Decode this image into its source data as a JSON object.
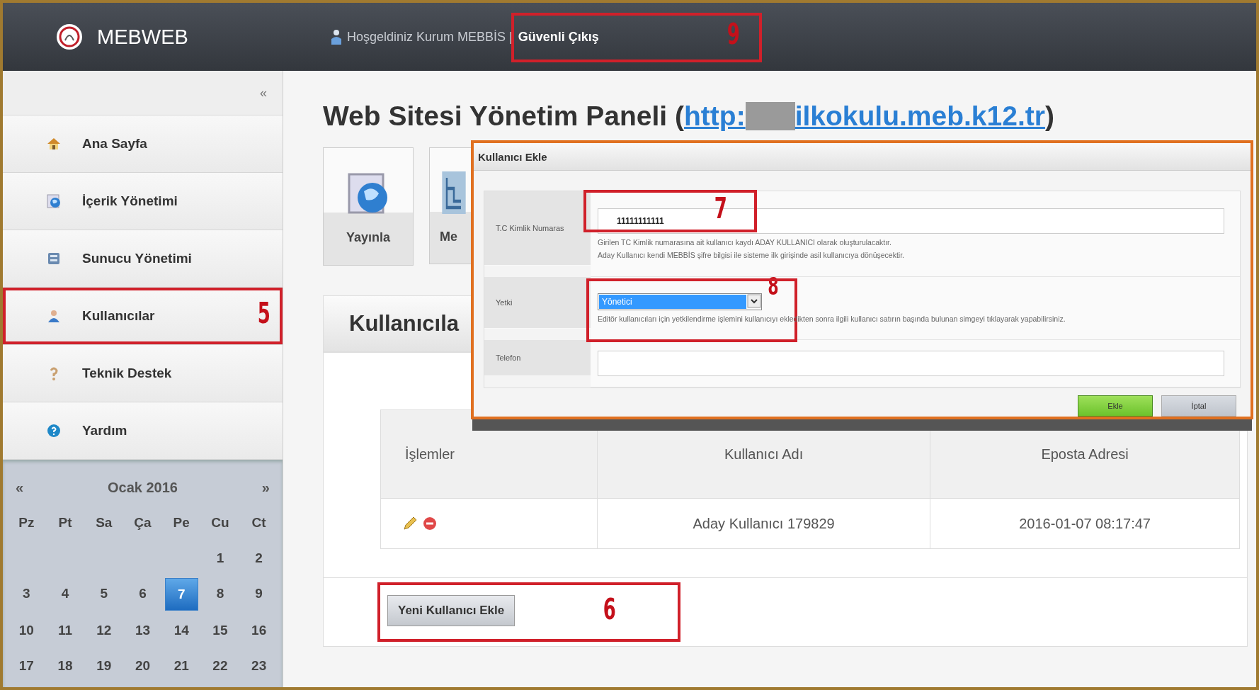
{
  "header": {
    "logo": "MEBWEB",
    "welcome": "Hoşgeldiniz Kurum MEBBİS |",
    "logout": "Güvenli Çıkış",
    "callout": "9"
  },
  "sidebar": {
    "collapse": "«",
    "items": [
      {
        "label": "Ana Sayfa",
        "selected": false
      },
      {
        "label": "İçerik Yönetimi",
        "selected": false
      },
      {
        "label": "Sunucu Yönetimi",
        "selected": false
      },
      {
        "label": "Kullanıcılar",
        "selected": false,
        "callout": "5"
      },
      {
        "label": "Teknik Destek",
        "selected": false
      },
      {
        "label": "Yardım",
        "selected": false
      }
    ]
  },
  "calendar": {
    "prev": "«",
    "month": "Ocak 2016",
    "next": "»",
    "weekdays": [
      "Pz",
      "Pt",
      "Sa",
      "Ça",
      "Pe",
      "Cu",
      "Ct"
    ],
    "weeks": [
      [
        {
          "day": "1",
          "selected": false
        },
        {
          "day": "2",
          "selected": false
        }
      ],
      [
        {
          "day": "3",
          "selected": false
        },
        {
          "day": "4",
          "selected": false
        },
        {
          "day": "5",
          "selected": false
        },
        {
          "day": "6",
          "selected": false
        },
        {
          "day": "7",
          "selected": true
        },
        {
          "day": "8",
          "selected": false
        },
        {
          "day": "9",
          "selected": false
        }
      ],
      [
        {
          "day": "10",
          "selected": false
        },
        {
          "day": "11",
          "selected": false
        },
        {
          "day": "12",
          "selected": false
        },
        {
          "day": "13",
          "selected": false
        },
        {
          "day": "14",
          "selected": false
        },
        {
          "day": "15",
          "selected": false
        },
        {
          "day": "16",
          "selected": false
        }
      ],
      [
        {
          "day": "17",
          "selected": false
        },
        {
          "day": "18",
          "selected": false
        },
        {
          "day": "19",
          "selected": false
        },
        {
          "day": "20",
          "selected": false
        },
        {
          "day": "21",
          "selected": false
        },
        {
          "day": "22",
          "selected": false
        },
        {
          "day": "23",
          "selected": false
        }
      ]
    ]
  },
  "page_title": {
    "text": "Web Sitesi Yönetim Paneli (",
    "link_start": "http:",
    "link_end": "ilkokulu.meb.k12.tr",
    "close": ")"
  },
  "tools": [
    {
      "label": "Yayınla"
    },
    {
      "label": "Me"
    }
  ],
  "users_panel": {
    "title": "Kullanıcıla",
    "actions_header": "İşlemler",
    "columns": [
      "Kullanıcı Adı",
      "Eposta Adresi"
    ],
    "rows": [
      {
        "cells": [
          "Aday Kullanıcı 179829",
          "2016-01-07 08:17:47"
        ]
      }
    ],
    "add_button": "Yeni Kullanıcı Ekle",
    "callout": "6"
  },
  "dialog": {
    "title": "Kullanıcı Ekle",
    "fields": [
      {
        "kind": "text",
        "label": "T.C Kimlik Numaras",
        "value": "11111111111",
        "callout": "7",
        "hints": [
          "Girilen TC Kimlik numarasına ait kullanıcı kaydı ADAY KULLANICI olarak oluşturulacaktır.",
          "Aday Kullanıcı kendi MEBBİS şifre bilgisi ile sisteme ilk girişinde asil kullanıcıya dönüşecektir."
        ]
      },
      {
        "kind": "select",
        "label": "Yetki",
        "value": "Yönetici",
        "callout": "8",
        "hints": [
          "Editör kullanıcıları için yetkilendirme işlemini kullanıcıyı ekledikten sonra ilgili kullanıcı satırın başında bulunan simgeyi tıklayarak yapabilirsiniz."
        ]
      },
      {
        "kind": "text",
        "label": "Telefon"
      }
    ],
    "buttons": [
      {
        "label": "Ekle",
        "kind": "primary"
      },
      {
        "label": "İptal",
        "kind": "secondary"
      }
    ]
  }
}
